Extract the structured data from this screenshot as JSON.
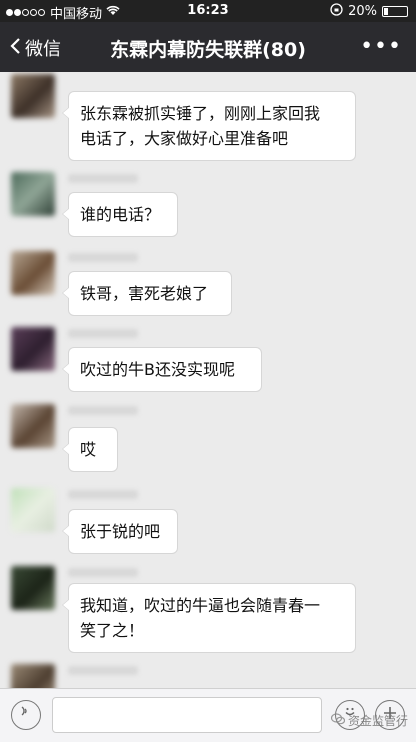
{
  "status_bar": {
    "carrier": "中国移动",
    "time": "16:23",
    "battery_text": "20%",
    "battery_level": 0.2
  },
  "nav": {
    "back_label": "微信",
    "title": "东霖内幕防失联群(80)",
    "more_label": "•••"
  },
  "messages": [
    {
      "text_line1": "张东霖被抓实锤了，刚刚上家回我",
      "text_line2": "电话了，大家做好心里准备吧"
    },
    {
      "text": "谁的电话？"
    },
    {
      "text": "铁哥，害死老娘了"
    },
    {
      "text": "吹过的牛B还没实现呢"
    },
    {
      "text": "哎"
    },
    {
      "text": "张于锐的吧"
    },
    {
      "text_line1": "我知道，吹过的牛逼也会随青春一",
      "text_line2": "笑了之！"
    }
  ],
  "input_bar": {
    "voice_icon": "voice-icon",
    "emoji_icon": "emoji-icon",
    "plus_icon": "plus-icon"
  },
  "watermark": {
    "text": "资金监管行"
  },
  "colors": {
    "nav_bg": "#2b2b2f",
    "status_bg": "#222222",
    "chat_bg": "#ebebeb",
    "bubble_bg": "#ffffff"
  }
}
